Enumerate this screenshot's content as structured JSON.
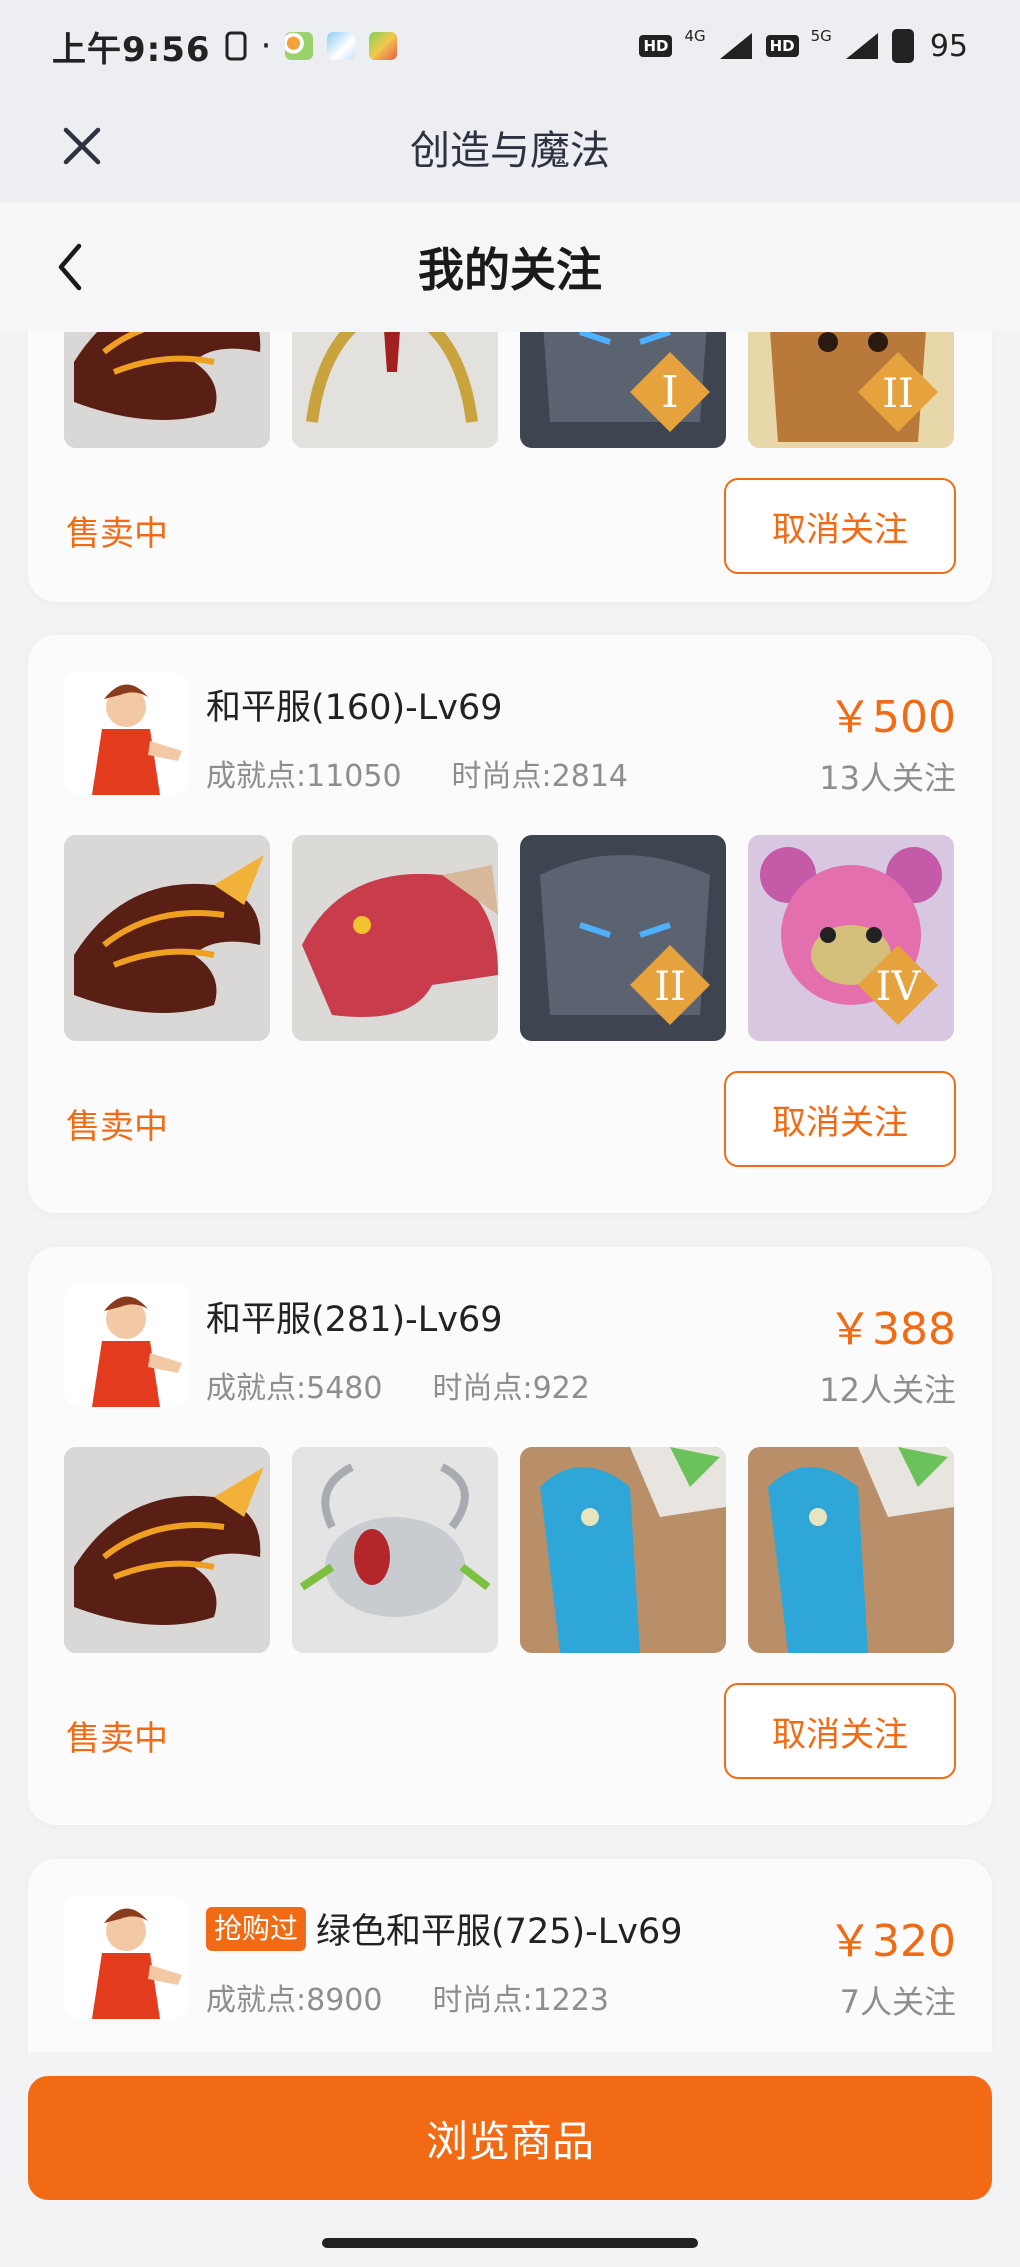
{
  "status_bar": {
    "time": "上午9:56",
    "net1": "4G",
    "net2": "5G",
    "hd": "HD",
    "battery": "95",
    "dot": "·"
  },
  "web_bar": {
    "title": "创造与魔法"
  },
  "header": {
    "title": "我的关注"
  },
  "cards": [
    {
      "status": "售卖中",
      "unfollow_label": "取消关注",
      "thumbs": [
        "dragon-lava",
        "golden-bow",
        "stone-golem-I",
        "wolf-mount-II"
      ]
    },
    {
      "name": "和平服(160)-Lv69",
      "achievement": "成就点:11050",
      "fashion": "时尚点:2814",
      "price": "￥500",
      "followers": "13人关注",
      "status": "售卖中",
      "unfollow_label": "取消关注",
      "thumbs": [
        "dragon-lava",
        "dragon-pink",
        "stone-golem-II",
        "pink-bear-IV"
      ]
    },
    {
      "name": "和平服(281)-Lv69",
      "achievement": "成就点:5480",
      "fashion": "时尚点:922",
      "price": "￥388",
      "followers": "12人关注",
      "status": "售卖中",
      "unfollow_label": "取消关注",
      "thumbs": [
        "dragon-lava",
        "silver-beetle",
        "blue-dino",
        "blue-dino"
      ]
    },
    {
      "tag": "抢购过",
      "name": "绿色和平服(725)-Lv69",
      "achievement": "成就点:8900",
      "fashion": "时尚点:1223",
      "price": "￥320",
      "followers": "7人关注"
    }
  ],
  "bottom": {
    "browse_label": "浏览商品"
  },
  "colors": {
    "accent": "#f26b14",
    "muted": "#8e8e92",
    "card_bg": "#fbfbfb",
    "page_bg": "#f3f3f5"
  },
  "icons": [
    "close-icon",
    "back-chevron-icon",
    "signal-icon",
    "battery-icon"
  ]
}
